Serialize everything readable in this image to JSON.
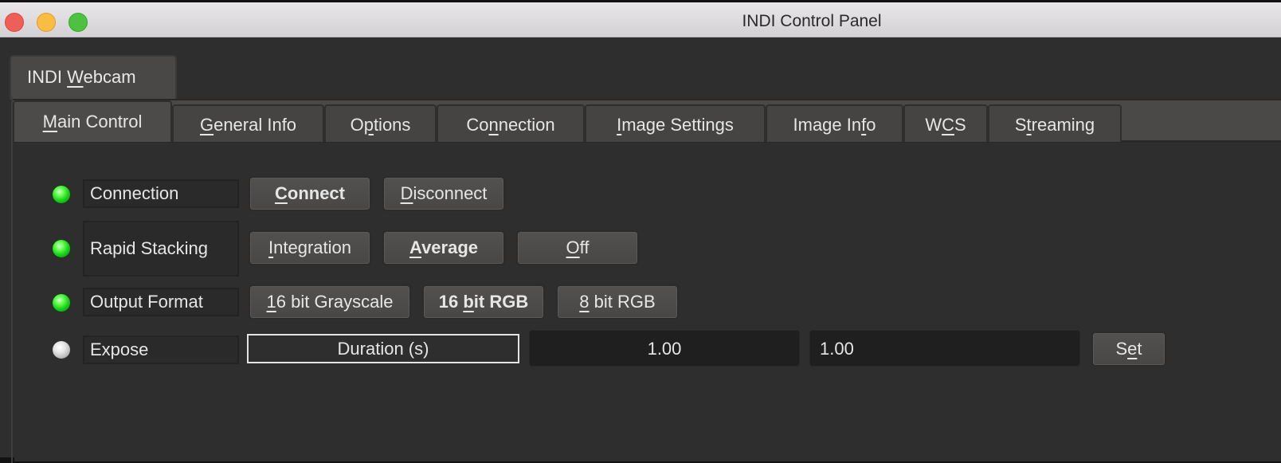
{
  "window": {
    "title": "INDI Control Panel",
    "controls": [
      "close",
      "minimize",
      "maximize"
    ]
  },
  "device_tab": {
    "label": "INDI Webcam",
    "mnemonic_index": 5
  },
  "group_tabs": [
    {
      "label": "Main Control",
      "active": true
    },
    {
      "label": "General Info",
      "active": false
    },
    {
      "label": "Options",
      "active": false
    },
    {
      "label": "Connection",
      "active": false
    },
    {
      "label": "Image Settings",
      "active": false
    },
    {
      "label": "Image Info",
      "active": false
    },
    {
      "label": "WCS",
      "active": false
    },
    {
      "label": "Streaming",
      "active": false
    }
  ],
  "properties": {
    "connection": {
      "label": "Connection",
      "state": "ok",
      "buttons": [
        {
          "label": "Connect",
          "selected": true
        },
        {
          "label": "Disconnect",
          "selected": false
        }
      ]
    },
    "rapid_stacking": {
      "label": "Rapid Stacking",
      "state": "ok",
      "buttons": [
        {
          "label": "Integration",
          "selected": false
        },
        {
          "label": "Average",
          "selected": true
        },
        {
          "label": "Off",
          "selected": false
        }
      ]
    },
    "output_format": {
      "label": "Output Format",
      "state": "ok",
      "buttons": [
        {
          "label": "16 bit Grayscale",
          "selected": false
        },
        {
          "label": "16 bit RGB",
          "selected": true
        },
        {
          "label": "8 bit RGB",
          "selected": false
        }
      ]
    },
    "expose": {
      "label": "Expose",
      "state": "idle",
      "element_label": "Duration (s)",
      "current_value": "1.00",
      "input_value": "1.00",
      "set_label": "Set"
    }
  },
  "colors": {
    "led_ok": "#19d61a",
    "led_idle": "#d0d0d0",
    "background": "#2e2e2e"
  }
}
